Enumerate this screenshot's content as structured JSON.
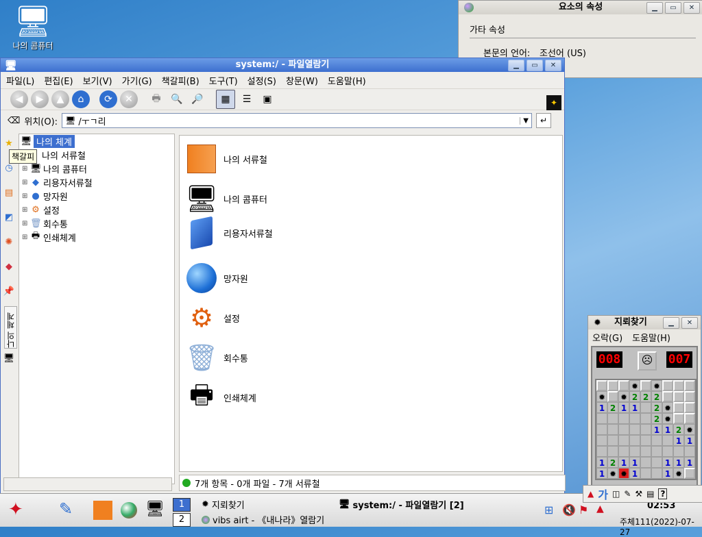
{
  "desktop": {
    "icon_label": "나의 콤퓨터"
  },
  "props_window": {
    "title": "요소의 속성",
    "section": "가타 속성",
    "lang_label": "본문의 언어:",
    "lang_value": "조선어 (US)"
  },
  "file_manager": {
    "title": "system:/ - 파일열람기",
    "menu": [
      "파일(L)",
      "편집(E)",
      "보기(V)",
      "가기(G)",
      "책갈피(B)",
      "도구(T)",
      "설정(S)",
      "창문(W)",
      "도움말(H)"
    ],
    "location_label": "위치(O):",
    "location_value": "/ㅜㄱ리",
    "tooltip": "책갈피",
    "side_label": "나의 체계",
    "tree": [
      {
        "label": "나의 체계",
        "icon": "computer"
      },
      {
        "label": "나의 서류철",
        "icon": "folder"
      },
      {
        "label": "나의 콤퓨터",
        "icon": "computer"
      },
      {
        "label": "리용자서류철",
        "icon": "book"
      },
      {
        "label": "망자원",
        "icon": "globe"
      },
      {
        "label": "설정",
        "icon": "gears"
      },
      {
        "label": "회수통",
        "icon": "trash"
      },
      {
        "label": "인쇄체계",
        "icon": "printer"
      }
    ],
    "items": [
      {
        "label": "나의 서류철",
        "icon": "folder"
      },
      {
        "label": "나의 콤퓨터",
        "icon": "computer"
      },
      {
        "label": "리용자서류철",
        "icon": "book"
      },
      {
        "label": "망자원",
        "icon": "globe"
      },
      {
        "label": "설정",
        "icon": "gears"
      },
      {
        "label": "회수통",
        "icon": "trash"
      },
      {
        "label": "인쇄체계",
        "icon": "printer"
      }
    ],
    "status": "7개 항목 - 0개 파일 - 7개 서류철"
  },
  "minesweeper": {
    "title": "지뢰찾기",
    "menu": [
      "오락(G)",
      "도움말(H)"
    ],
    "mines_left": "008",
    "timer": "007",
    "grid": [
      [
        "c",
        "c",
        "c",
        "x",
        "c",
        "x",
        "c",
        "c",
        "c"
      ],
      [
        "x",
        "c",
        "x",
        "2",
        "2",
        "2",
        "c",
        "c",
        "c"
      ],
      [
        "1",
        "2",
        "1",
        "1",
        "o",
        "2",
        "x",
        "c",
        "c"
      ],
      [
        "o",
        "o",
        "o",
        "o",
        "o",
        "2",
        "x",
        "c",
        "c"
      ],
      [
        "o",
        "o",
        "o",
        "o",
        "o",
        "1",
        "1",
        "2",
        "x"
      ],
      [
        "o",
        "o",
        "o",
        "o",
        "o",
        "o",
        "o",
        "1",
        "1"
      ],
      [
        "o",
        "o",
        "o",
        "o",
        "o",
        "o",
        "o",
        "o",
        "o"
      ],
      [
        "1",
        "2",
        "1",
        "1",
        "o",
        "o",
        "1",
        "1",
        "1"
      ],
      [
        "1",
        "x",
        "X",
        "1",
        "o",
        "o",
        "1",
        "x",
        "c"
      ]
    ]
  },
  "taskbar": {
    "desktops": [
      "1",
      "2"
    ],
    "tasks": [
      "지뢰찾기",
      "system:/ - 파일열람기 [2]",
      "vibs airt - 《내나라》열람기"
    ],
    "clock": "02:53",
    "date": "주체111(2022)-07-27",
    "ime_label": "가"
  }
}
